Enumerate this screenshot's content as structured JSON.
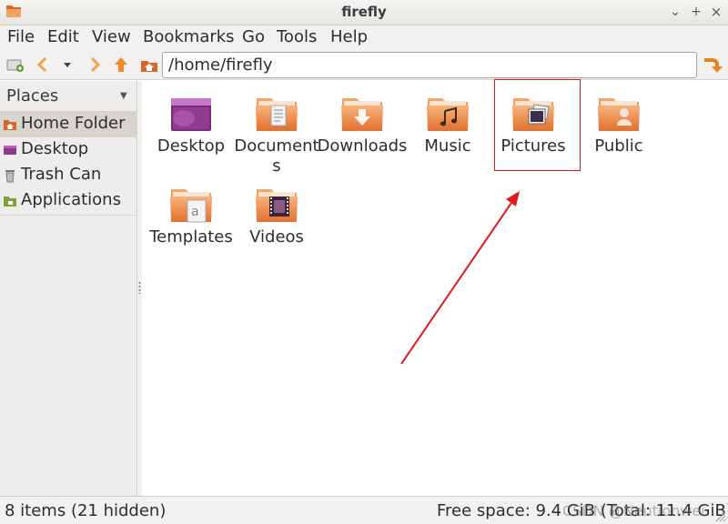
{
  "window": {
    "title": "firefly",
    "minimize_glyph": "⌄",
    "maximize_glyph": "+",
    "close_glyph": "×"
  },
  "menu": {
    "items": [
      "File",
      "Edit",
      "View",
      "Bookmarks",
      "Go",
      "Tools",
      "Help"
    ]
  },
  "toolbar": {
    "location": "/home/firefly",
    "icons": [
      "new-tab-icon",
      "back-icon",
      "history-dropdown-icon",
      "forward-icon",
      "up-icon",
      "home-icon",
      "go-icon"
    ]
  },
  "sidebar": {
    "header": "Places",
    "items": [
      {
        "label": "Home Folder",
        "icon": "home-folder-icon",
        "selected": true
      },
      {
        "label": "Desktop",
        "icon": "desktop-icon",
        "selected": false
      },
      {
        "label": "Trash Can",
        "icon": "trash-icon",
        "selected": false
      },
      {
        "label": "Applications",
        "icon": "applications-icon",
        "selected": false
      }
    ]
  },
  "files": [
    {
      "label": "Desktop",
      "icon": "desktop-folder-icon"
    },
    {
      "label": "Documents",
      "icon": "documents-folder-icon"
    },
    {
      "label": "Downloads",
      "icon": "downloads-folder-icon"
    },
    {
      "label": "Music",
      "icon": "music-folder-icon"
    },
    {
      "label": "Pictures",
      "icon": "pictures-folder-icon",
      "highlighted": true
    },
    {
      "label": "Public",
      "icon": "public-folder-icon"
    },
    {
      "label": "Templates",
      "icon": "templates-folder-icon"
    },
    {
      "label": "Videos",
      "icon": "videos-folder-icon"
    }
  ],
  "status": {
    "items": "8 items (21 hidden)",
    "free_space": "Free space: 9.4 GiB (Total: 11.4 GiB)",
    "watermark": "CSDN @Neutionwei"
  },
  "colors": {
    "folder": "#e67e3c",
    "folder_light": "#f4a061",
    "annotation": "#e0191e",
    "selection": "#d8d5cf"
  }
}
